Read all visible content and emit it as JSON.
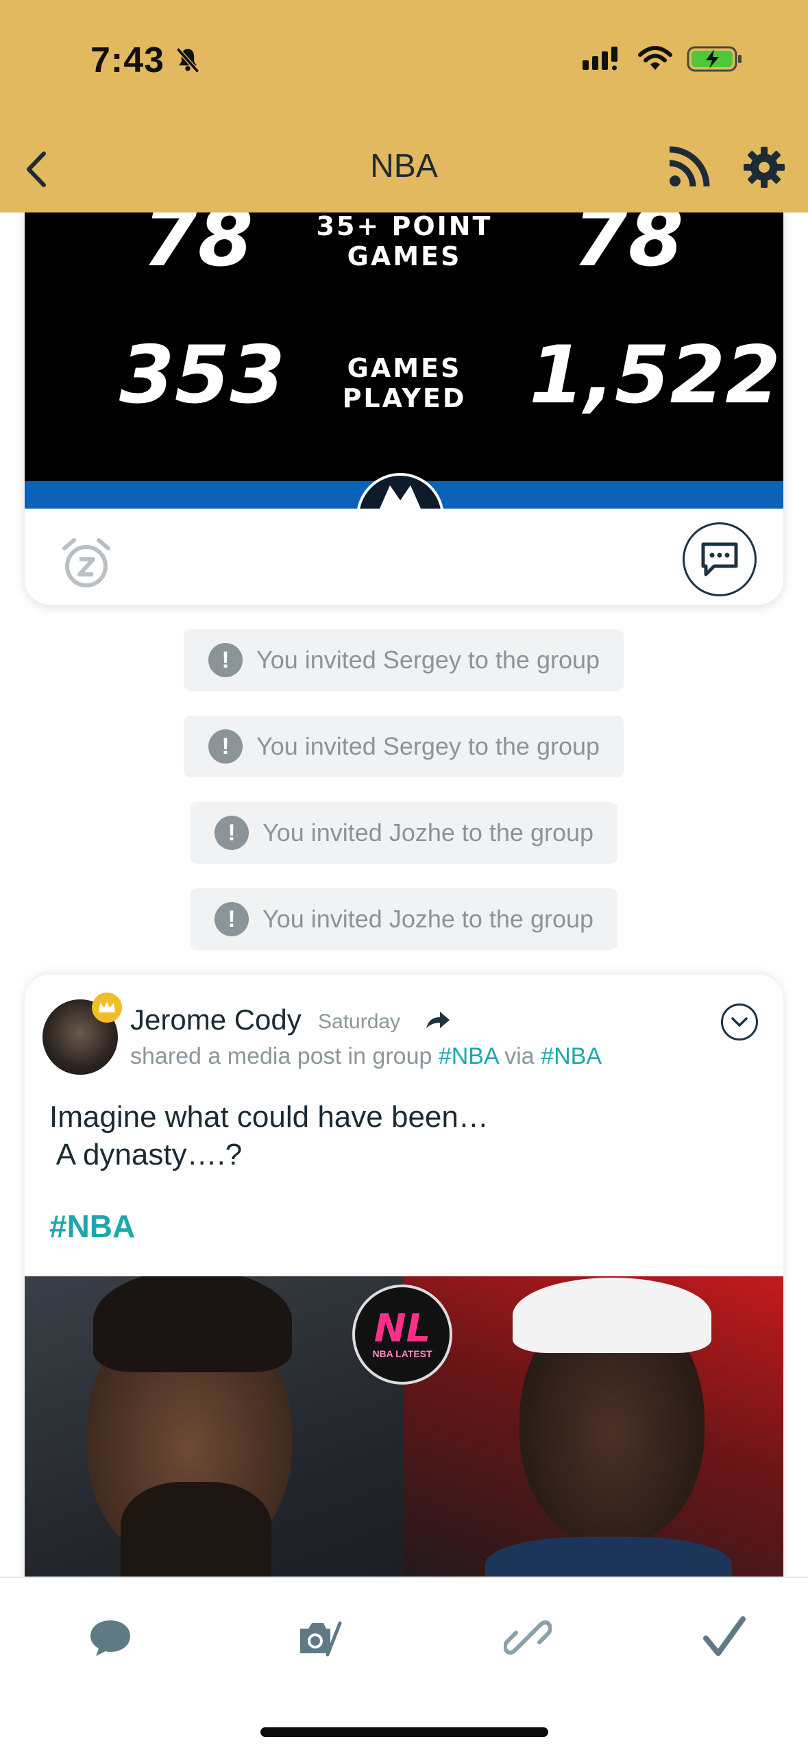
{
  "status_bar": {
    "time": "7:43"
  },
  "nav": {
    "title": "NBA"
  },
  "stats_graphic": {
    "rows": [
      {
        "left": "78",
        "label_line1": "35+ POINT",
        "label_line2": "GAMES",
        "right": "78"
      },
      {
        "left": "353",
        "label_line1": "GAMES",
        "label_line2": "PLAYED",
        "right": "1,522"
      }
    ]
  },
  "notices": [
    "You invited Sergey to the group",
    "You invited Sergey to the group",
    "You invited Jozhe to the group",
    "You invited Jozhe to the group"
  ],
  "post": {
    "author": "Jerome Cody",
    "time": "Saturday",
    "sub_prefix": "shared a media post in group",
    "group_tag": "#NBA",
    "via_word": "via",
    "via_tag": "#NBA",
    "body": "Imagine what could have been…\n A dynasty….?",
    "hashtag": "#NBA",
    "media_badge": "NL",
    "media_badge_sub": "NBA LATEST"
  },
  "icons": {
    "status": [
      "bell-slash-icon",
      "signal-icon",
      "wifi-icon",
      "battery-charging-icon"
    ],
    "nav": [
      "back-icon",
      "rss-icon",
      "gear-icon"
    ],
    "toolbar": [
      "chat-bubble-icon",
      "camera-icon",
      "link-icon",
      "checkmark-icon"
    ]
  },
  "colors": {
    "header_bg": "#e2b95e",
    "accent_teal": "#1ca7ad",
    "notice_bg": "#f1f2f4",
    "crown": "#f2bd2a"
  }
}
